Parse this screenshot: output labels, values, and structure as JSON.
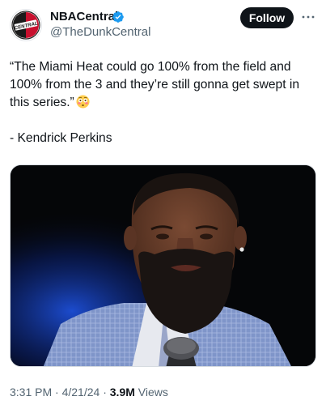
{
  "author": {
    "display_name": "NBACentral",
    "handle": "@TheDunkCentral",
    "avatar_text": "CENTRAL",
    "verified": true,
    "verified_color": "#1d9bf0"
  },
  "actions": {
    "follow_label": "Follow",
    "more_icon": "more-horizontal-icon"
  },
  "tweet": {
    "line1": "“The Miami Heat could go 100% from the field and",
    "line2": "100% from the 3 and they’re still gonna get swept in",
    "line3": "this series.”",
    "emoji": "flushed-face-emoji",
    "attribution": "- Kendrick Perkins"
  },
  "media": {
    "type": "photo",
    "subject": "man-with-beard-in-blue-suit-with-microphone"
  },
  "meta": {
    "time": "3:31 PM",
    "sep1": " · ",
    "date": "4/21/24",
    "sep2": " · ",
    "views_count": "3.9M",
    "views_label": " Views"
  },
  "colors": {
    "text_primary": "#0f1419",
    "text_secondary": "#536471",
    "button_bg": "#0f1419",
    "button_text": "#ffffff",
    "brand_red": "#c8102e"
  }
}
